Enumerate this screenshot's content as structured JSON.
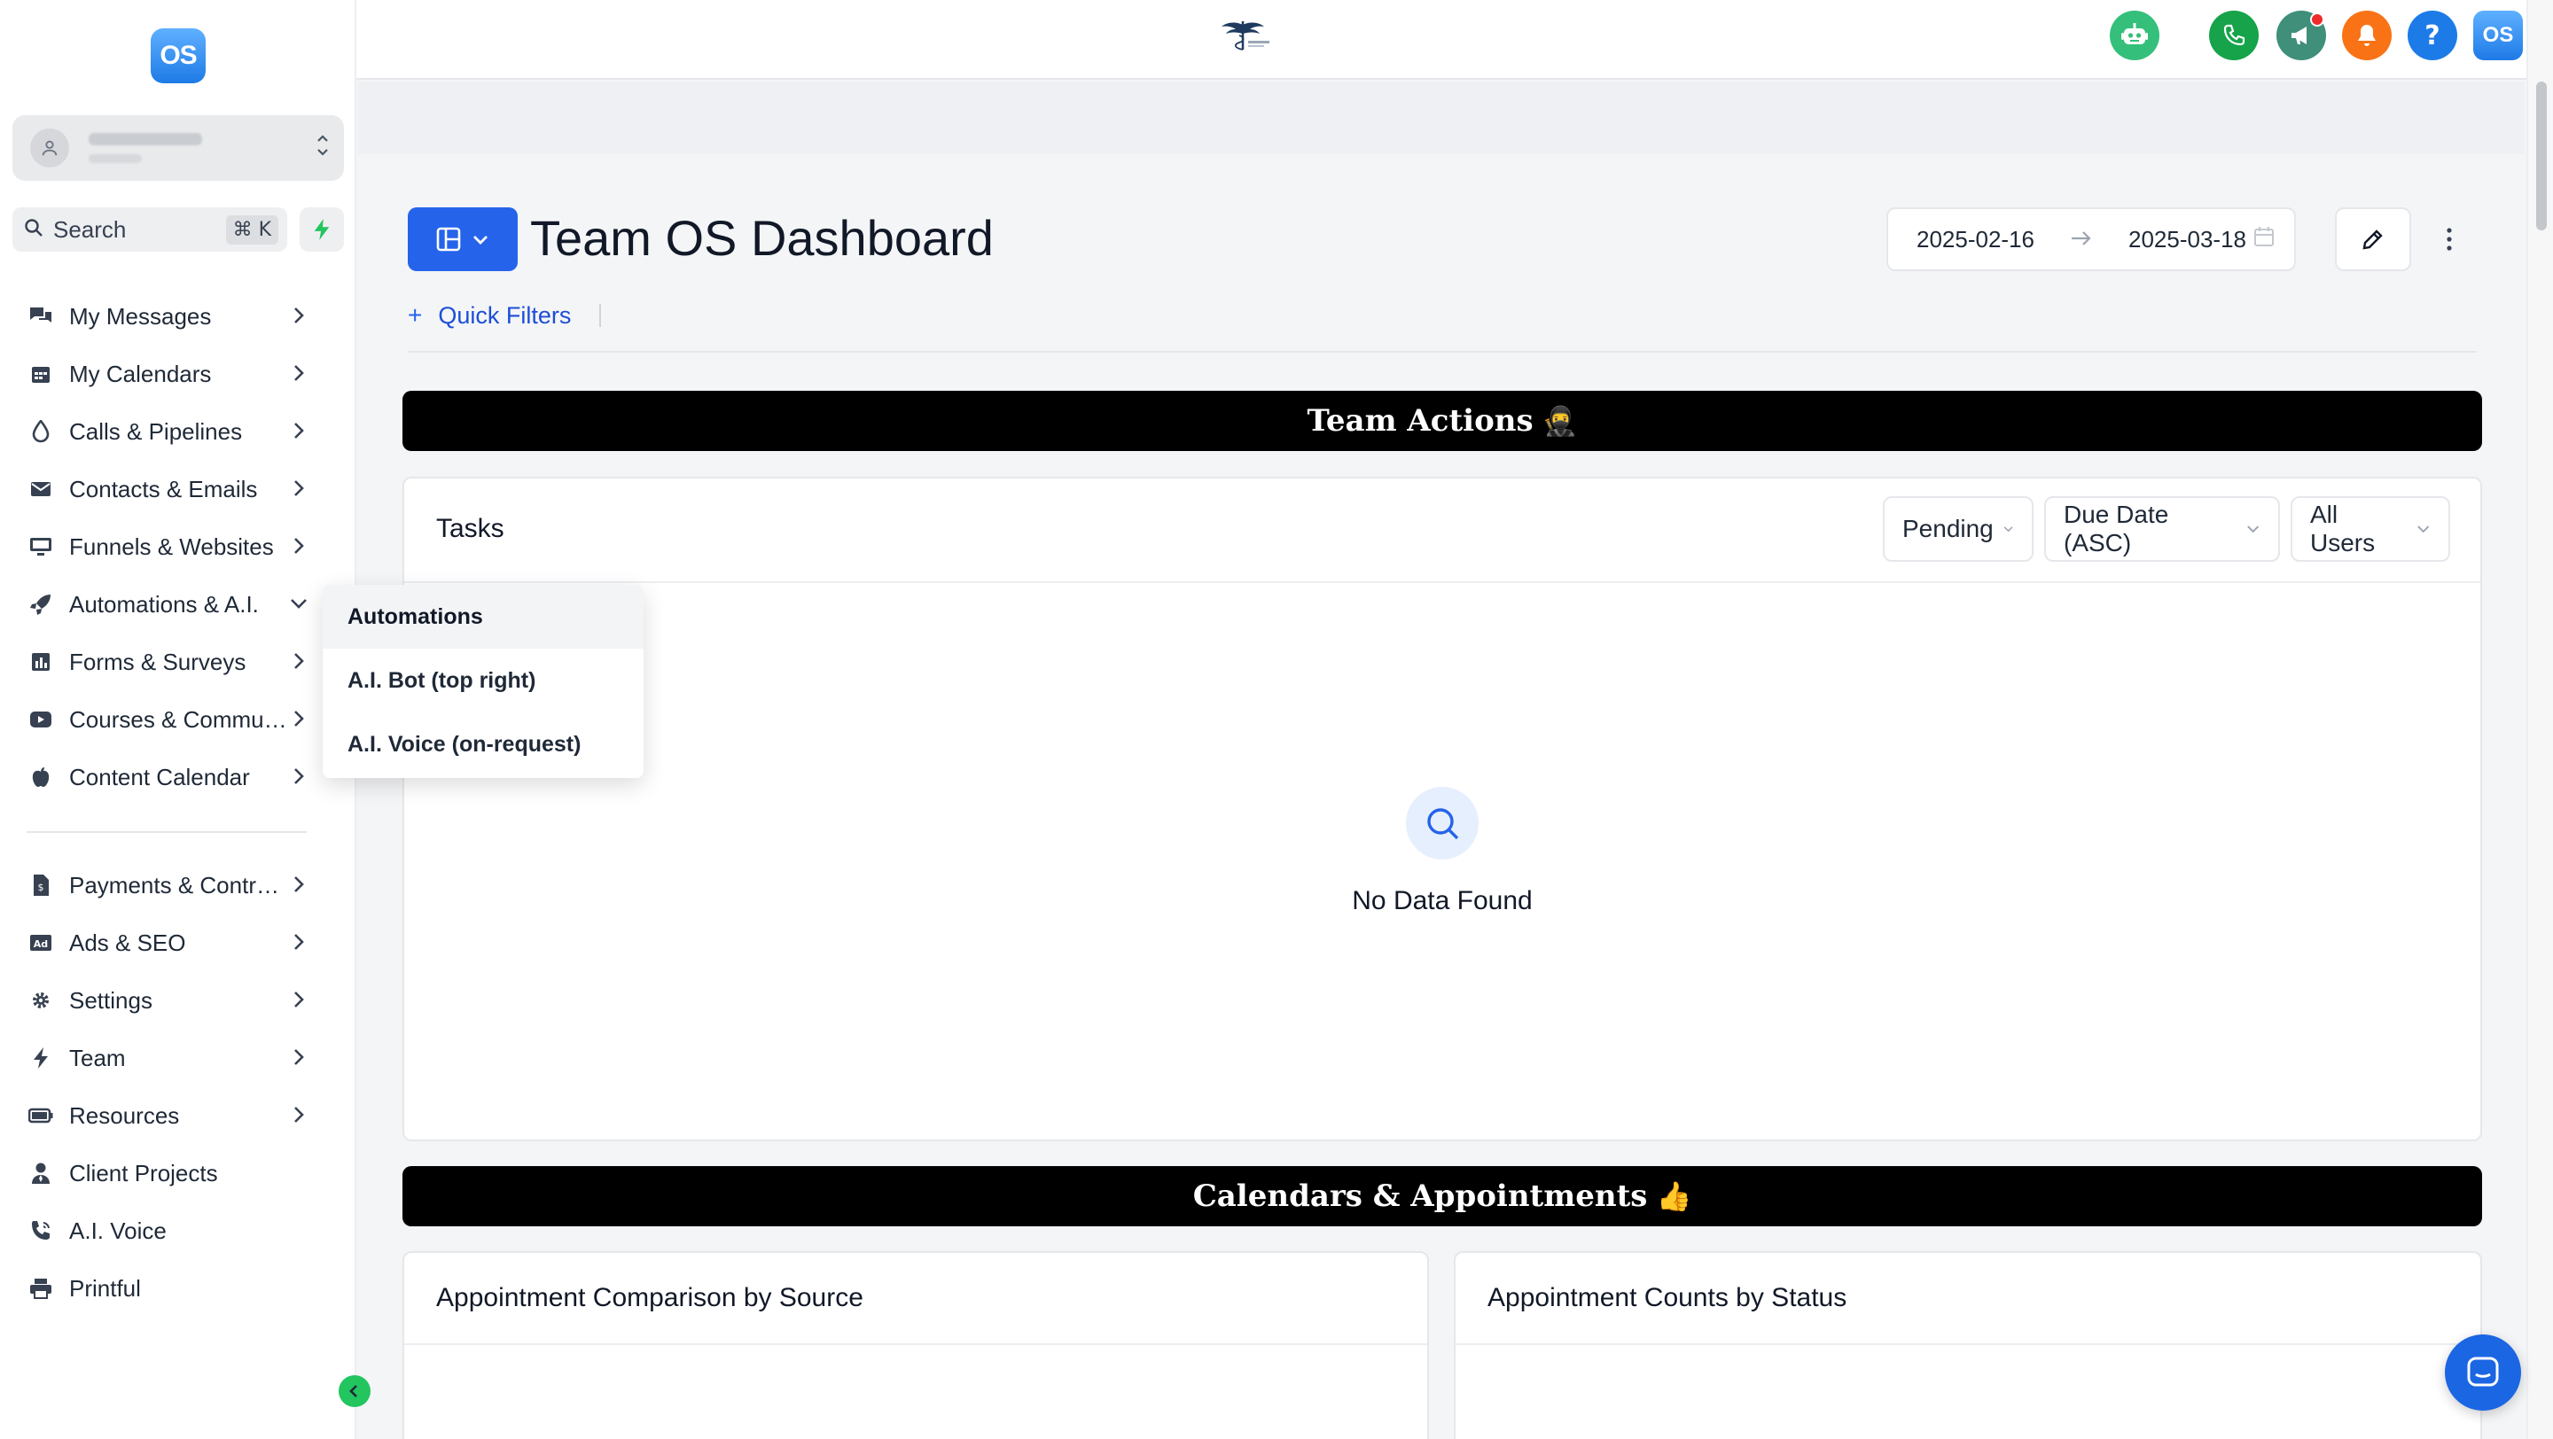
{
  "sidebar": {
    "logo_text": "OS",
    "search": {
      "label": "Search",
      "shortcut": "⌘ K"
    },
    "items": [
      {
        "label": "My Messages",
        "icon": "messages-icon"
      },
      {
        "label": "My Calendars",
        "icon": "calendar-icon"
      },
      {
        "label": "Calls & Pipelines",
        "icon": "funnel-drop-icon"
      },
      {
        "label": "Contacts & Emails",
        "icon": "mail-icon"
      },
      {
        "label": "Funnels & Websites",
        "icon": "monitor-icon"
      },
      {
        "label": "Automations & A.I.",
        "icon": "rocket-icon"
      },
      {
        "label": "Forms & Surveys",
        "icon": "bar-chart-icon"
      },
      {
        "label": "Courses & Commun...",
        "icon": "youtube-icon"
      },
      {
        "label": "Content Calendar",
        "icon": "apple-icon"
      },
      {
        "label": "Payments & Contra...",
        "icon": "invoice-icon"
      },
      {
        "label": "Ads & SEO",
        "icon": "ad-icon"
      },
      {
        "label": "Settings",
        "icon": "gear-icon"
      },
      {
        "label": "Team",
        "icon": "bolt-icon"
      },
      {
        "label": "Resources",
        "icon": "battery-icon"
      },
      {
        "label": "Client Projects",
        "icon": "user-tie-icon"
      },
      {
        "label": "A.I. Voice",
        "icon": "phone-volume-icon"
      },
      {
        "label": "Printful",
        "icon": "printer-icon"
      }
    ]
  },
  "flyout": {
    "items": [
      "Automations",
      "A.I. Bot (top right)",
      "A.I. Voice (on-request)"
    ]
  },
  "header": {
    "title": "Team OS Dashboard",
    "quick_filters": "Quick Filters",
    "date_from": "2025-02-16",
    "date_to": "2025-03-18",
    "avatar_text": "OS"
  },
  "sections": {
    "team_actions": {
      "label": "Team Actions",
      "emoji": "🥷"
    },
    "calendars": {
      "label": "Calendars & Appointments",
      "emoji": "👍"
    }
  },
  "tasks": {
    "title": "Tasks",
    "filters": [
      "Pending",
      "Due Date (ASC)",
      "All Users"
    ],
    "empty_text": "No Data Found"
  },
  "cards": {
    "appointment_source": "Appointment Comparison by Source",
    "appointment_status": "Appointment Counts by Status"
  },
  "colors": {
    "primary": "#2563eb",
    "green": "#16a34a",
    "orange": "#f97316",
    "teal": "#3f8f7a",
    "help": "#1d7be8"
  }
}
